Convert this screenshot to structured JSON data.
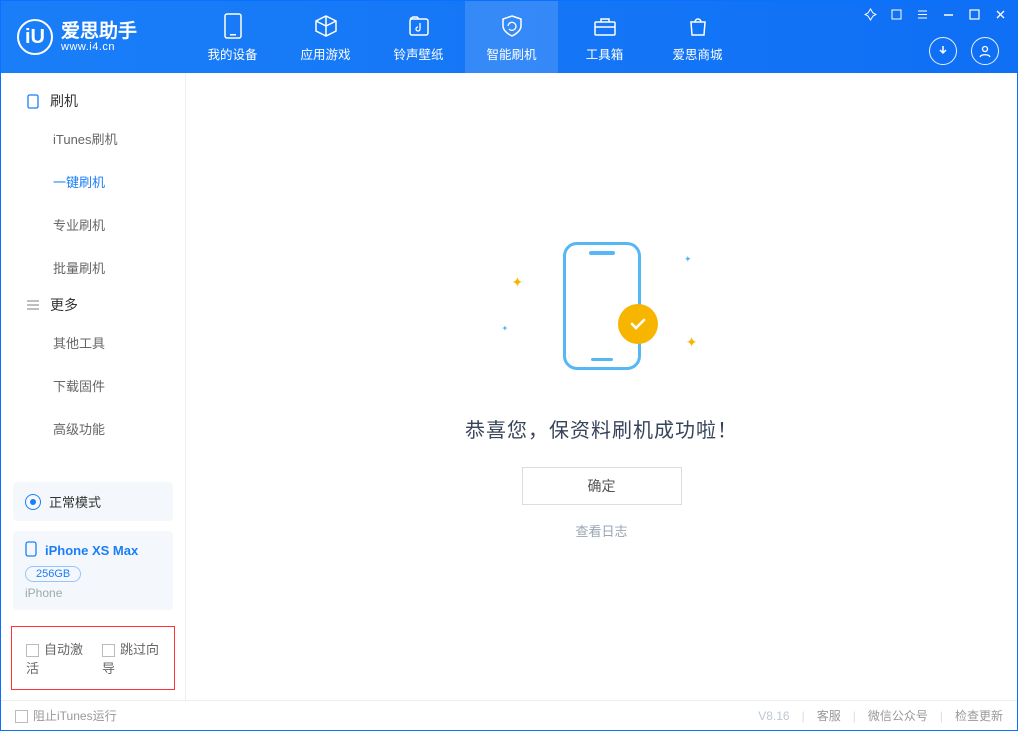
{
  "app": {
    "name": "爱思助手",
    "url": "www.i4.cn"
  },
  "nav": {
    "items": [
      {
        "label": "我的设备"
      },
      {
        "label": "应用游戏"
      },
      {
        "label": "铃声壁纸"
      },
      {
        "label": "智能刷机"
      },
      {
        "label": "工具箱"
      },
      {
        "label": "爱思商城"
      }
    ]
  },
  "sidebar": {
    "group1": {
      "title": "刷机",
      "items": [
        {
          "label": "iTunes刷机"
        },
        {
          "label": "一键刷机"
        },
        {
          "label": "专业刷机"
        },
        {
          "label": "批量刷机"
        }
      ]
    },
    "group2": {
      "title": "更多",
      "items": [
        {
          "label": "其他工具"
        },
        {
          "label": "下载固件"
        },
        {
          "label": "高级功能"
        }
      ]
    },
    "mode_label": "正常模式",
    "device": {
      "name": "iPhone XS Max",
      "storage": "256GB",
      "type": "iPhone"
    },
    "chk_auto_activate": "自动激活",
    "chk_skip_guide": "跳过向导"
  },
  "main": {
    "success_title": "恭喜您，保资料刷机成功啦！",
    "ok_btn": "确定",
    "view_log": "查看日志"
  },
  "footer": {
    "block_itunes": "阻止iTunes运行",
    "version": "V8.16",
    "links": [
      "客服",
      "微信公众号",
      "检查更新"
    ]
  }
}
